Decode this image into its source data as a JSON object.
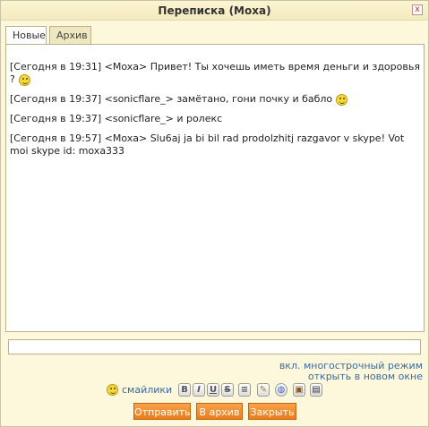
{
  "window": {
    "title": "Переписка (Moxa)",
    "close_label": "x"
  },
  "tabs": [
    {
      "label": "Новые",
      "active": true
    },
    {
      "label": "Архив",
      "active": false
    }
  ],
  "messages": [
    {
      "text": "[Сегодня в 19:31] <Moxa> Привет! Ты хочешь иметь время деньги и здоровья ?",
      "smiley": true
    },
    {
      "text": "[Сегодня в 19:37] <sonicflare_> замётано, гони почку и бабло",
      "smiley": true
    },
    {
      "text": "[Сегодня в 19:37] <sonicflare_> и ролекс",
      "smiley": false
    },
    {
      "text": "[Сегодня в 19:57] <Moxa> Slu6aj ja bi bil rad prodolzhitj razgavor v skype! Vot moi skype id: moxa333",
      "smiley": false
    }
  ],
  "input": {
    "value": ""
  },
  "links": {
    "multiline": "вкл. многострочный режим",
    "new_window": "открыть в новом окне",
    "smileys": "смайлики"
  },
  "format_tools": [
    {
      "icon": "bold-icon",
      "glyph": "B"
    },
    {
      "icon": "italic-icon",
      "glyph": "I"
    },
    {
      "icon": "underline-icon",
      "glyph": "U"
    },
    {
      "icon": "strikethrough-icon",
      "glyph": "S"
    },
    {
      "icon": "align-center-icon",
      "glyph": "≡"
    },
    {
      "icon": "edit-icon",
      "glyph": "✎"
    },
    {
      "icon": "globe-icon",
      "glyph": "◍"
    },
    {
      "icon": "image-icon",
      "glyph": "▣"
    },
    {
      "icon": "video-icon",
      "glyph": "▤"
    }
  ],
  "buttons": {
    "send": "Отправить",
    "archive": "В архив",
    "close": "Закрыть"
  }
}
